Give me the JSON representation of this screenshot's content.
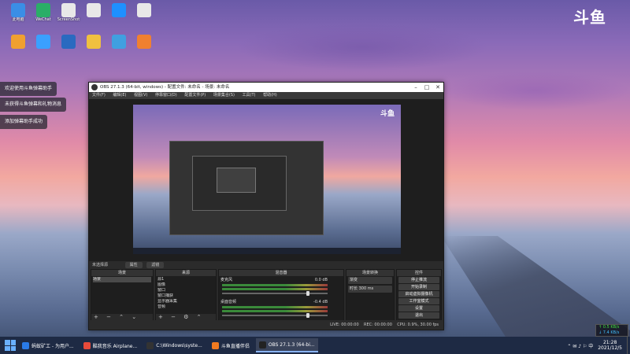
{
  "brand_logo": "斗鱼",
  "desktop_icons": [
    {
      "label": "此电脑",
      "color": "#3a8ee6"
    },
    {
      "label": "WeChat",
      "color": "#2aae67"
    },
    {
      "label": "ScreenShot",
      "color": "#e8e8e8"
    },
    {
      "label": "",
      "color": "#e8e8e8"
    },
    {
      "label": "",
      "color": "#1e90ff"
    },
    {
      "label": "",
      "color": "#e8e8e8"
    },
    {
      "label": "",
      "color": "#f0a030"
    },
    {
      "label": "",
      "color": "#3aa0ff"
    },
    {
      "label": "",
      "color": "#2a6ac0"
    },
    {
      "label": "",
      "color": "#f0c040"
    },
    {
      "label": "",
      "color": "#40a0e0"
    },
    {
      "label": "",
      "color": "#f08030"
    }
  ],
  "notifications": [
    "欢迎使用斗鱼弹幕助手",
    "未获得斗鱼弹幕和礼物消息",
    "添加弹幕助手成功"
  ],
  "obs": {
    "title": "OBS 27.1.3 (64-bit, windows) - 配置文件: 未命名 - 场景: 未命名",
    "menu": [
      "文件(F)",
      "编辑(E)",
      "视图(V)",
      "停靠窗口(D)",
      "配置文件(P)",
      "场景集合(S)",
      "工具(T)",
      "帮助(H)"
    ],
    "preview_logo": "斗鱼",
    "no_source_label": "未选择源",
    "properties_btn": "属性",
    "filters_btn": "滤镜",
    "scenes": {
      "title": "场景",
      "items": [
        "场景"
      ]
    },
    "sources": {
      "title": "来源",
      "items": [
        "源1",
        "图像",
        "窗口",
        "窗口捕获",
        "显示器采集",
        "音频"
      ]
    },
    "mixer": {
      "title": "混音器",
      "channels": [
        {
          "name": "麦克风",
          "db": "0.0 dB"
        },
        {
          "name": "桌面音频",
          "db": "-0.4 dB"
        }
      ]
    },
    "transitions": {
      "title": "场景转换",
      "type": "渐变",
      "duration_label": "时长",
      "duration": "300 ms"
    },
    "controls": {
      "title": "控件",
      "buttons": [
        "停止推流",
        "开始录制",
        "启动虚拟摄像机",
        "工作室模式",
        "设置",
        "退出"
      ]
    },
    "status": {
      "live": "LIVE: 00:00:00",
      "rec": "REC: 00:00:00",
      "cpu": "CPU: 0.9%, 30.00 fps"
    }
  },
  "taskbar": {
    "apps": [
      {
        "label": "蚂蚁矿工 - 为用户...",
        "color": "#2a7ae6",
        "active": false
      },
      {
        "label": "酷我音乐 Airplane...",
        "color": "#e84a3a",
        "active": false
      },
      {
        "label": "C:\\Windows\\syste...",
        "color": "#333333",
        "active": false
      },
      {
        "label": "斗鱼直播伴侣",
        "color": "#f07a20",
        "active": false
      },
      {
        "label": "OBS 27.1.3 (64-bi...",
        "color": "#222222",
        "active": true
      }
    ],
    "time": "21:28",
    "date": "2021/12/5"
  },
  "net_speed": {
    "up": "↑ 0.5 KB/s",
    "down": "↓ 7.4 KB/s"
  }
}
